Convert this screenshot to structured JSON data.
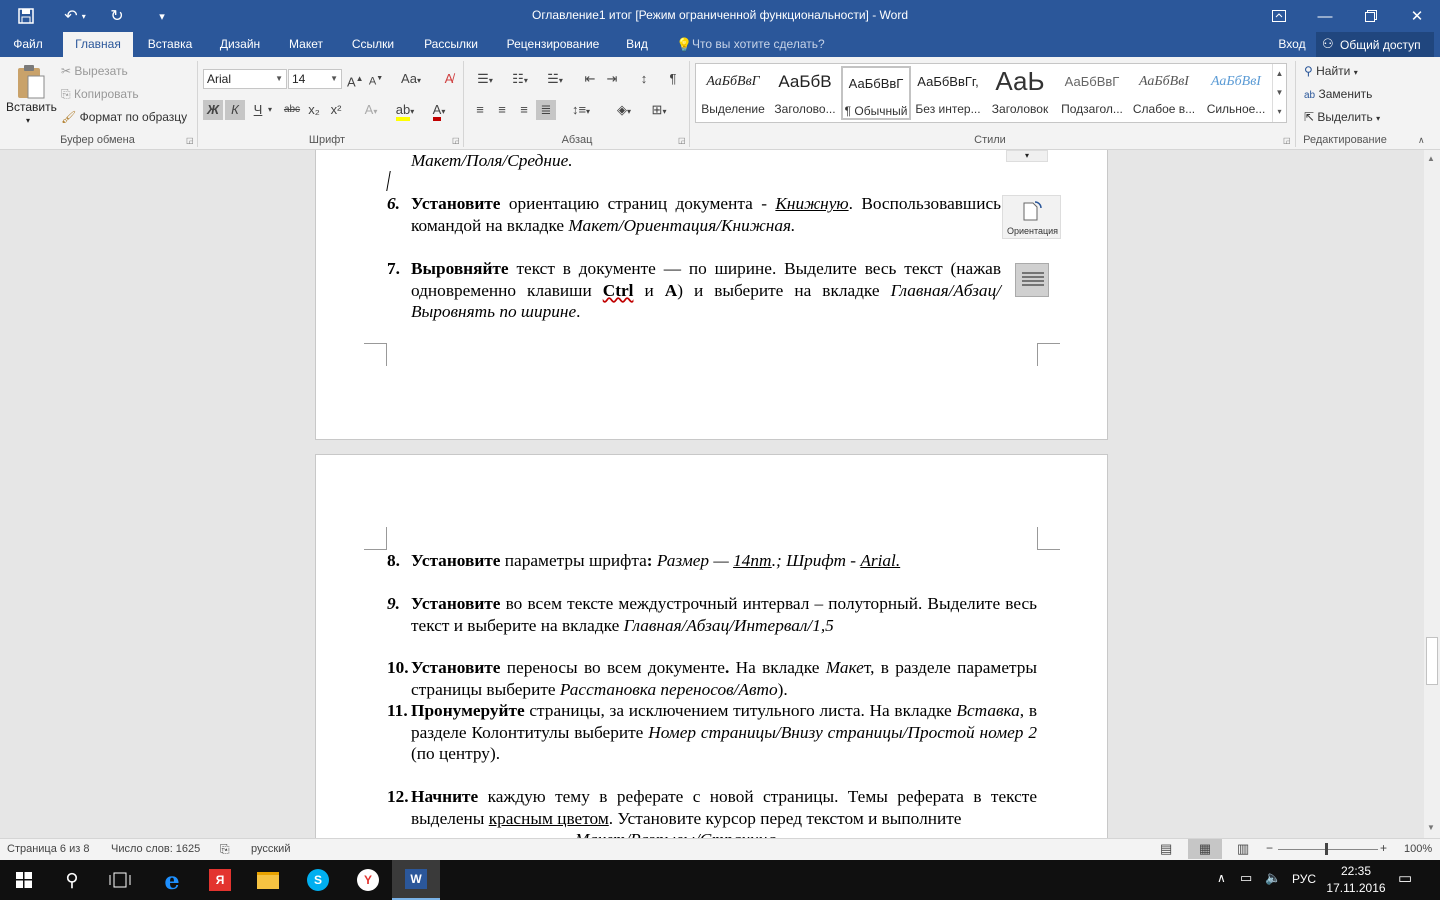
{
  "window": {
    "title": "Оглавление1 итог [Режим ограниченной функциональности] - Word"
  },
  "tabs": [
    "Файл",
    "Главная",
    "Вставка",
    "Дизайн",
    "Макет",
    "Ссылки",
    "Рассылки",
    "Рецензирование",
    "Вид"
  ],
  "tell_me": "Что вы хотите сделать?",
  "signin": "Вход",
  "share": "Общий доступ",
  "clipboard": {
    "paste": "Вставить",
    "cut": "Вырезать",
    "copy": "Копировать",
    "format_painter": "Формат по образцу",
    "label": "Буфер обмена"
  },
  "font": {
    "name": "Arial",
    "size": "14",
    "label": "Шрифт",
    "bold": "Ж",
    "italic": "К",
    "underline": "Ч",
    "strike": "abc",
    "sub": "x₂",
    "sup": "x²",
    "case": "Aa"
  },
  "paragraph": {
    "label": "Абзац"
  },
  "styles": {
    "label": "Стили",
    "items": [
      {
        "sample": "АаБбВвГ",
        "name": "Выделение"
      },
      {
        "sample": "АаБбВ",
        "name": "Заголово..."
      },
      {
        "sample": "АаБбВвГ",
        "name": "¶ Обычный"
      },
      {
        "sample": "АаБбВвГг,",
        "name": "Без интер..."
      },
      {
        "sample": "АаЬ",
        "name": "Заголовок"
      },
      {
        "sample": "АаБбВвГ",
        "name": "Подзагол..."
      },
      {
        "sample": "АаБбВвI",
        "name": "Слабое в..."
      },
      {
        "sample": "АаБбВвI",
        "name": "Сильное..."
      }
    ]
  },
  "editing": {
    "label": "Редактирование",
    "find": "Найти",
    "replace": "Заменить",
    "select": "Выделить"
  },
  "doc": {
    "top_line": "Макет/Поля/Средние.",
    "item6": {
      "num": "6.",
      "b": "Установите",
      "t1": " ориентацию страниц документа - ",
      "u": "Книжную",
      "t2": ". Воспользовавшись командой на вкладке ",
      "i": "Макет/Ориентация/Книжная."
    },
    "orientation_label": "Ориентация",
    "item7": {
      "num": "7.",
      "b": "Выровняйте",
      "t1": " текст в документе — по ширине. Выделите весь текст (нажав одновременно клавиши ",
      "k1": "Ctrl",
      "t2": " и ",
      "k2": "А",
      "t3": ") и выберите на вкладке ",
      "i": "Главная/Абзац/Выровнять по ширине",
      "t4": "."
    },
    "item8": {
      "num": "8.",
      "b": "Установите",
      "t1": " параметры шрифта",
      "colon": ":",
      "i1": " Размер — ",
      "u1": "14пт",
      "i2": ".; Шрифт - ",
      "u2": "Arial."
    },
    "item9": {
      "num": "9.",
      "b": "Установите",
      "t1": " во всем тексте междустрочный интервал – полуторный. Выделите весь текст и выберите на вкладке ",
      "i": "Главная/Абзац/Интервал/1,5"
    },
    "item10": {
      "num": "10.",
      "b": "Установите",
      "t1": " переносы во всем документе",
      "dot": ".",
      "t2": " На вкладке ",
      "i1": "Маке",
      "t3": "т, в разделе параметры страницы выберите ",
      "i2": "Расстановка переносов/Авто",
      "t4": ")."
    },
    "item11": {
      "num": "11.",
      "b": "Пронумеруйте",
      "t1": " страницы, за исключением титульного листа. На вкладке ",
      "i1": "Вставка",
      "t2": ", в разделе Колонтитулы выберите ",
      "i2": "Номер страницы/Внизу страницы/Простой номер 2",
      "t3": " (по центру)."
    },
    "item12": {
      "num": "12.",
      "b": "Начните",
      "t1": " каждую тему в реферате с новой страницы. Темы реферата в тексте выделены ",
      "u": "красным цветом",
      "t2": ". Установите курсор перед текстом и выполните",
      "t3": "Макет/Разрывы/Страница"
    }
  },
  "status": {
    "page": "Страница 6 из 8",
    "words": "Число слов: 1625",
    "lang": "русский",
    "zoom": "100%"
  },
  "taskbar": {
    "lang": "РУС",
    "time": "22:35",
    "date": "17.11.2016"
  },
  "colors": {
    "word_blue": "#2b579a",
    "font_color": "#c00000",
    "highlight": "#ffff00"
  }
}
